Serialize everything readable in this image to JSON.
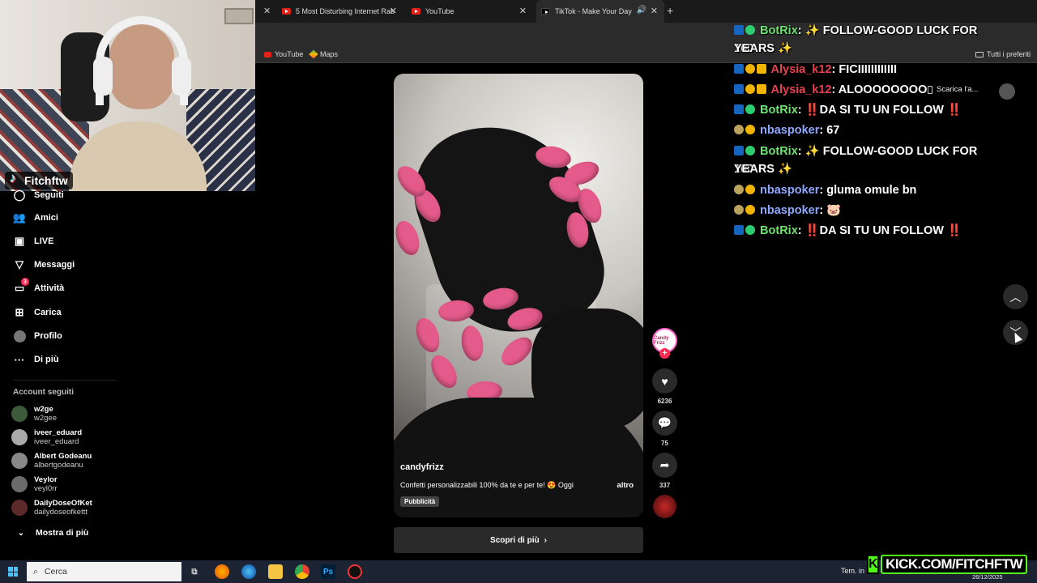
{
  "browser": {
    "tabs": [
      {
        "title": "5 Most Disturbing Internet Rab",
        "active": false
      },
      {
        "title": "YouTube",
        "active": false
      },
      {
        "title": "TikTok - Make Your Day",
        "active": true
      }
    ],
    "bookmarks": [
      "YouTube",
      "Maps"
    ],
    "bookmarks_right": "Tutti i preferiti"
  },
  "webcam": {
    "streamer_name": "Fitchftw"
  },
  "sidebar": {
    "nav": [
      {
        "label": "Seguiti",
        "icon": "following-icon"
      },
      {
        "label": "Amici",
        "icon": "friends-icon"
      },
      {
        "label": "LIVE",
        "icon": "live-icon"
      },
      {
        "label": "Messaggi",
        "icon": "messages-icon"
      },
      {
        "label": "Attività",
        "icon": "activity-icon",
        "badge": "3"
      },
      {
        "label": "Carica",
        "icon": "upload-icon"
      },
      {
        "label": "Profilo",
        "icon": "profile-icon"
      },
      {
        "label": "Di più",
        "icon": "more-icon"
      }
    ],
    "section_title": "Account seguiti",
    "accounts": [
      {
        "name": "w2ge",
        "handle": "w2gee"
      },
      {
        "name": "iveer_eduard",
        "handle": "iveer_eduard"
      },
      {
        "name": "Albert Godeanu",
        "handle": "albertgodeanu"
      },
      {
        "name": "Veylor",
        "handle": "veyl0rr"
      },
      {
        "name": "DailyDoseOfKet",
        "handle": "dailydoseofkettt"
      }
    ],
    "show_more": "Mostra di più"
  },
  "video": {
    "username": "candyfrizz",
    "caption": "Confetti personalizzabili 100% da te e per te! 😍 Oggi",
    "more": "altro",
    "ad_label": "Pubblicità",
    "cta": "Scopri di più",
    "likes": "6236",
    "comments": "75",
    "shares": "337",
    "avatar_text": "Candy Frizz"
  },
  "top_right": {
    "download": "Scarica l'a..."
  },
  "chat": [
    {
      "user": "BotRix",
      "text": ": ✨ FOLLOW-GOOD LUCK FOR 100",
      "cont": "YEARS ✨",
      "kind": "bot"
    },
    {
      "user": "Alysia_k12",
      "text": ": FICIIIIIIIIIIII",
      "kind": "alys"
    },
    {
      "user": "Alysia_k12",
      "text": ": ALOOOOOOOO",
      "kind": "alys"
    },
    {
      "user": "BotRix",
      "text": ": ‼️DA SI TU UN FOLLOW ‼️",
      "kind": "bot"
    },
    {
      "user": "nbaspoker",
      "text": ": 67",
      "kind": "nbas"
    },
    {
      "user": "BotRix",
      "text": ": ✨ FOLLOW-GOOD LUCK FOR 100",
      "cont": "YEARS ✨",
      "kind": "bot"
    },
    {
      "user": "nbaspoker",
      "text": ": gluma omule bn",
      "kind": "nbas"
    },
    {
      "user": "nbaspoker",
      "text": ": 🐷",
      "kind": "nbas"
    },
    {
      "user": "BotRix",
      "text": ": ‼️DA SI TU UN FOLLOW ‼️",
      "kind": "bot"
    }
  ],
  "taskbar": {
    "search_placeholder": "Cerca",
    "tray_text": "Tem. in",
    "date": "26/12/2025"
  },
  "overlay": {
    "kick_url": "KICK.COM/FITCHFTW"
  },
  "colors": {
    "tiktok_red": "#fe2c55",
    "botrix_green": "#6ee36e",
    "alysia_red": "#e8404e",
    "nbaspoker_blue": "#8fa8ff",
    "kick_green": "#53fc18"
  }
}
